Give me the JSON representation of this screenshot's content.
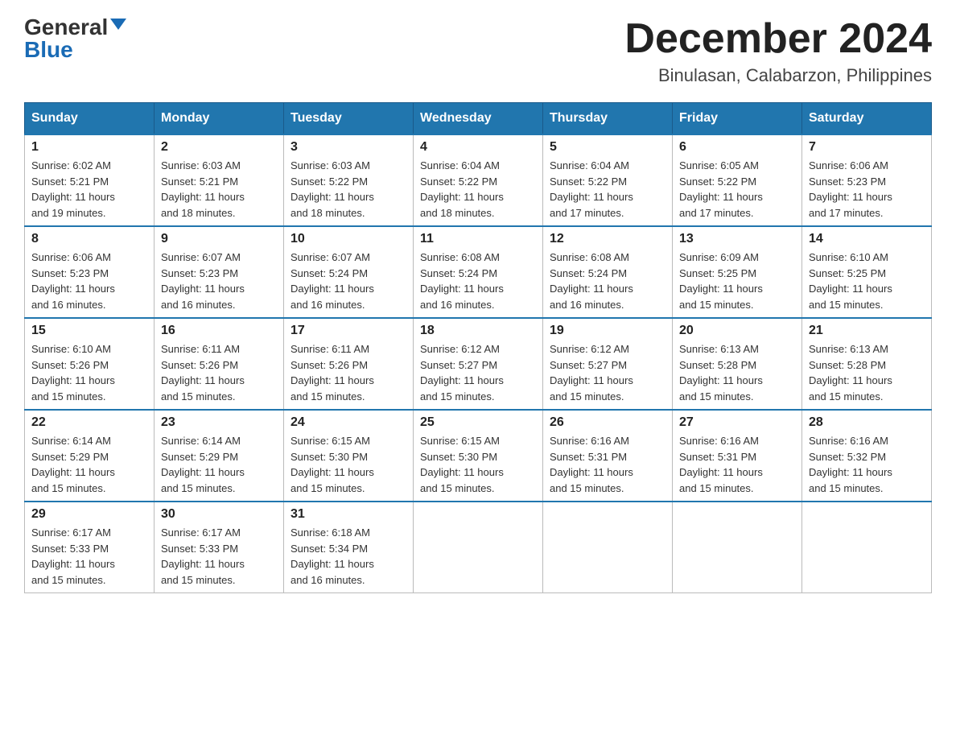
{
  "header": {
    "logo_general": "General",
    "logo_blue": "Blue",
    "month_title": "December 2024",
    "location": "Binulasan, Calabarzon, Philippines"
  },
  "days_of_week": [
    "Sunday",
    "Monday",
    "Tuesday",
    "Wednesday",
    "Thursday",
    "Friday",
    "Saturday"
  ],
  "weeks": [
    [
      {
        "day": "1",
        "sunrise": "6:02 AM",
        "sunset": "5:21 PM",
        "daylight": "11 hours and 19 minutes."
      },
      {
        "day": "2",
        "sunrise": "6:03 AM",
        "sunset": "5:21 PM",
        "daylight": "11 hours and 18 minutes."
      },
      {
        "day": "3",
        "sunrise": "6:03 AM",
        "sunset": "5:22 PM",
        "daylight": "11 hours and 18 minutes."
      },
      {
        "day": "4",
        "sunrise": "6:04 AM",
        "sunset": "5:22 PM",
        "daylight": "11 hours and 18 minutes."
      },
      {
        "day": "5",
        "sunrise": "6:04 AM",
        "sunset": "5:22 PM",
        "daylight": "11 hours and 17 minutes."
      },
      {
        "day": "6",
        "sunrise": "6:05 AM",
        "sunset": "5:22 PM",
        "daylight": "11 hours and 17 minutes."
      },
      {
        "day": "7",
        "sunrise": "6:06 AM",
        "sunset": "5:23 PM",
        "daylight": "11 hours and 17 minutes."
      }
    ],
    [
      {
        "day": "8",
        "sunrise": "6:06 AM",
        "sunset": "5:23 PM",
        "daylight": "11 hours and 16 minutes."
      },
      {
        "day": "9",
        "sunrise": "6:07 AM",
        "sunset": "5:23 PM",
        "daylight": "11 hours and 16 minutes."
      },
      {
        "day": "10",
        "sunrise": "6:07 AM",
        "sunset": "5:24 PM",
        "daylight": "11 hours and 16 minutes."
      },
      {
        "day": "11",
        "sunrise": "6:08 AM",
        "sunset": "5:24 PM",
        "daylight": "11 hours and 16 minutes."
      },
      {
        "day": "12",
        "sunrise": "6:08 AM",
        "sunset": "5:24 PM",
        "daylight": "11 hours and 16 minutes."
      },
      {
        "day": "13",
        "sunrise": "6:09 AM",
        "sunset": "5:25 PM",
        "daylight": "11 hours and 15 minutes."
      },
      {
        "day": "14",
        "sunrise": "6:10 AM",
        "sunset": "5:25 PM",
        "daylight": "11 hours and 15 minutes."
      }
    ],
    [
      {
        "day": "15",
        "sunrise": "6:10 AM",
        "sunset": "5:26 PM",
        "daylight": "11 hours and 15 minutes."
      },
      {
        "day": "16",
        "sunrise": "6:11 AM",
        "sunset": "5:26 PM",
        "daylight": "11 hours and 15 minutes."
      },
      {
        "day": "17",
        "sunrise": "6:11 AM",
        "sunset": "5:26 PM",
        "daylight": "11 hours and 15 minutes."
      },
      {
        "day": "18",
        "sunrise": "6:12 AM",
        "sunset": "5:27 PM",
        "daylight": "11 hours and 15 minutes."
      },
      {
        "day": "19",
        "sunrise": "6:12 AM",
        "sunset": "5:27 PM",
        "daylight": "11 hours and 15 minutes."
      },
      {
        "day": "20",
        "sunrise": "6:13 AM",
        "sunset": "5:28 PM",
        "daylight": "11 hours and 15 minutes."
      },
      {
        "day": "21",
        "sunrise": "6:13 AM",
        "sunset": "5:28 PM",
        "daylight": "11 hours and 15 minutes."
      }
    ],
    [
      {
        "day": "22",
        "sunrise": "6:14 AM",
        "sunset": "5:29 PM",
        "daylight": "11 hours and 15 minutes."
      },
      {
        "day": "23",
        "sunrise": "6:14 AM",
        "sunset": "5:29 PM",
        "daylight": "11 hours and 15 minutes."
      },
      {
        "day": "24",
        "sunrise": "6:15 AM",
        "sunset": "5:30 PM",
        "daylight": "11 hours and 15 minutes."
      },
      {
        "day": "25",
        "sunrise": "6:15 AM",
        "sunset": "5:30 PM",
        "daylight": "11 hours and 15 minutes."
      },
      {
        "day": "26",
        "sunrise": "6:16 AM",
        "sunset": "5:31 PM",
        "daylight": "11 hours and 15 minutes."
      },
      {
        "day": "27",
        "sunrise": "6:16 AM",
        "sunset": "5:31 PM",
        "daylight": "11 hours and 15 minutes."
      },
      {
        "day": "28",
        "sunrise": "6:16 AM",
        "sunset": "5:32 PM",
        "daylight": "11 hours and 15 minutes."
      }
    ],
    [
      {
        "day": "29",
        "sunrise": "6:17 AM",
        "sunset": "5:33 PM",
        "daylight": "11 hours and 15 minutes."
      },
      {
        "day": "30",
        "sunrise": "6:17 AM",
        "sunset": "5:33 PM",
        "daylight": "11 hours and 15 minutes."
      },
      {
        "day": "31",
        "sunrise": "6:18 AM",
        "sunset": "5:34 PM",
        "daylight": "11 hours and 16 minutes."
      },
      null,
      null,
      null,
      null
    ]
  ],
  "labels": {
    "sunrise": "Sunrise:",
    "sunset": "Sunset:",
    "daylight": "Daylight:"
  }
}
